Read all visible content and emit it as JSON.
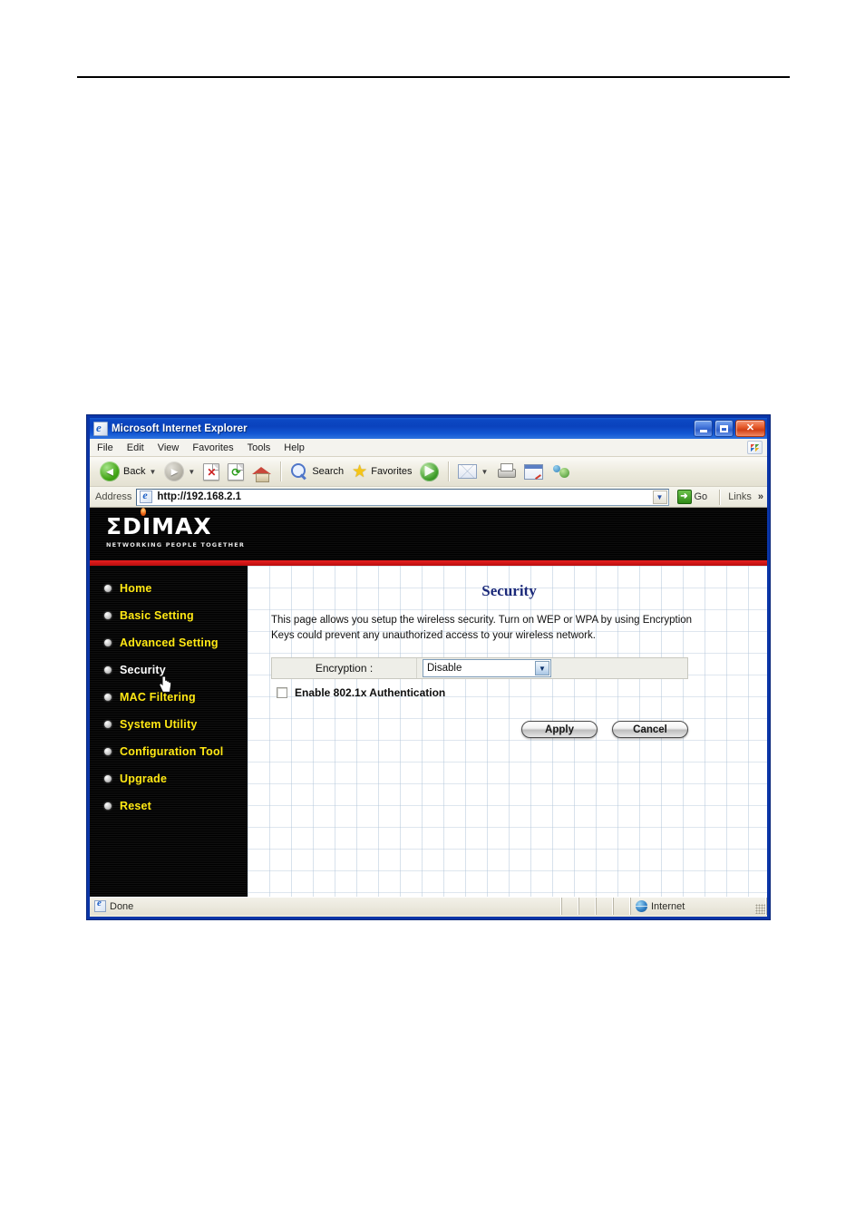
{
  "browser": {
    "title": "Microsoft Internet Explorer",
    "title_icon": "ie-page-icon",
    "window_buttons": {
      "minimize": "minimize-button",
      "maximize": "maximize-button",
      "close": "close-button",
      "close_glyph": "✕"
    },
    "menu": [
      "File",
      "Edit",
      "View",
      "Favorites",
      "Tools",
      "Help"
    ],
    "toolbar": {
      "back_label": "Back",
      "back_glyph": "◄",
      "forward_glyph": "►",
      "dropdown_glyph": "▼",
      "search_label": "Search",
      "favorites_label": "Favorites",
      "items": [
        {
          "name": "back-button",
          "label": "Back"
        },
        {
          "name": "forward-button",
          "label": ""
        },
        {
          "name": "stop-button",
          "label": ""
        },
        {
          "name": "refresh-button",
          "label": ""
        },
        {
          "name": "home-button",
          "label": ""
        },
        {
          "name": "search-button",
          "label": "Search"
        },
        {
          "name": "favorites-button",
          "label": "Favorites"
        },
        {
          "name": "media-button",
          "label": ""
        },
        {
          "name": "mail-button",
          "label": ""
        },
        {
          "name": "print-button",
          "label": ""
        },
        {
          "name": "edit-button",
          "label": ""
        },
        {
          "name": "messenger-button",
          "label": ""
        }
      ],
      "stop_glyph": "✖",
      "refresh_glyph": "⟳"
    },
    "address": {
      "label": "Address",
      "value": "http://192.168.2.1",
      "placeholder": "http://",
      "dropdown_glyph": "▼",
      "go_label": "Go",
      "go_glyph": "➜",
      "links_label": "Links",
      "links_chevron": "»"
    },
    "status": {
      "left_text": "Done",
      "zone_text": "Internet",
      "zone_icon": "globe-icon"
    }
  },
  "router": {
    "brand": {
      "name": "ΣDIMAX",
      "tagline": "NETWORKING PEOPLE TOGETHER"
    },
    "sidebar": {
      "items": [
        {
          "label": "Home",
          "active": false
        },
        {
          "label": "Basic Setting",
          "active": false
        },
        {
          "label": "Advanced Setting",
          "active": false
        },
        {
          "label": "Security",
          "active": true
        },
        {
          "label": "MAC Filtering",
          "active": false
        },
        {
          "label": "System Utility",
          "active": false
        },
        {
          "label": "Configuration Tool",
          "active": false
        },
        {
          "label": "Upgrade",
          "active": false
        },
        {
          "label": "Reset",
          "active": false
        }
      ]
    },
    "main": {
      "title": "Security",
      "description": "This page allows you setup the wireless security. Turn on WEP or WPA by using Encryption Keys could prevent any unauthorized access to your wireless network.",
      "encryption_label": "Encryption :",
      "encryption_value": "Disable",
      "encryption_options": [
        "Disable"
      ],
      "encryption_arrow": "▼",
      "auth_checkbox_label": "Enable 802.1x Authentication",
      "auth_checkbox_checked": false,
      "apply_label": "Apply",
      "cancel_label": "Cancel"
    },
    "colors": {
      "nav_text": "#ffe814",
      "nav_active_text": "#ffffff",
      "accent_red": "#e81f1f",
      "title_blue": "#1c2a7a",
      "banner_black": "#050505"
    }
  }
}
